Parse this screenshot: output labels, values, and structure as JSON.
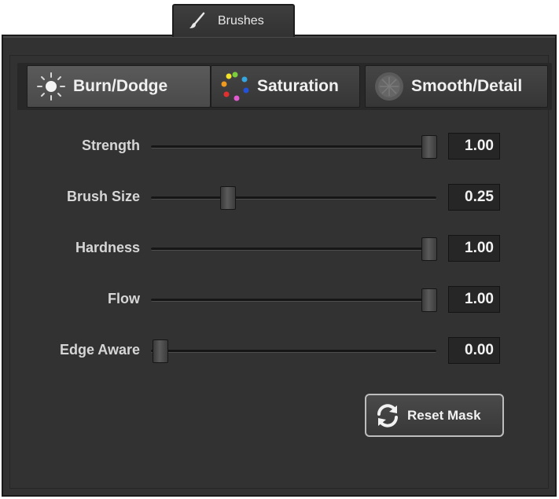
{
  "tab": {
    "label": "Brushes",
    "icon": "brush-icon"
  },
  "modes": [
    {
      "label": "Burn/Dodge",
      "icon": "sun-icon",
      "active": true
    },
    {
      "label": "Saturation",
      "icon": "color-dots-icon",
      "active": false
    },
    {
      "label": "Smooth/Detail",
      "icon": "texture-icon",
      "active": false
    }
  ],
  "sliders": [
    {
      "label": "Strength",
      "value": "1.00",
      "level": 1.0
    },
    {
      "label": "Brush Size",
      "value": "0.25",
      "level": 0.25
    },
    {
      "label": "Hardness",
      "value": "1.00",
      "level": 1.0
    },
    {
      "label": "Flow",
      "value": "1.00",
      "level": 1.0
    },
    {
      "label": "Edge Aware",
      "value": "0.00",
      "level": 0.0
    }
  ],
  "reset": {
    "label": "Reset Mask",
    "icon": "refresh-icon"
  }
}
